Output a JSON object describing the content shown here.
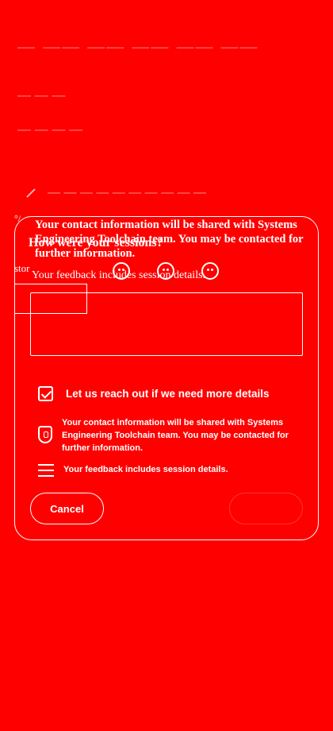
{
  "background": {
    "line1": "— —— —— —— —— ——",
    "line2": "— — —",
    "line3": "— — — —",
    "line4": "— — — — — — — — — —"
  },
  "overlay": {
    "info_ghost": "Your contact information will be shared with Systems Engineering Toolchain team. You may be contacted for further information.",
    "question": "How were your sessions?",
    "feedback_ghost": "Your feedback includes session details.",
    "story_label": "stor",
    "corner": "°/"
  },
  "form": {
    "feedback_placeholder": "",
    "reach_out_label": "Let us reach out if we need more details",
    "reach_out_checked": true,
    "contact_info": "Your contact information will be shared with Systems Engineering Toolchain team. You may be contacted for further information.",
    "session_info": "Your feedback includes session details.",
    "cancel_label": "Cancel",
    "submit_label": ""
  },
  "icons": {
    "check": "check-icon",
    "shield": "shield-lock-icon",
    "details": "list-lines-icon",
    "pen": "pen-icon"
  },
  "colors": {
    "background": "#ff0000",
    "foreground": "#ffffff"
  }
}
